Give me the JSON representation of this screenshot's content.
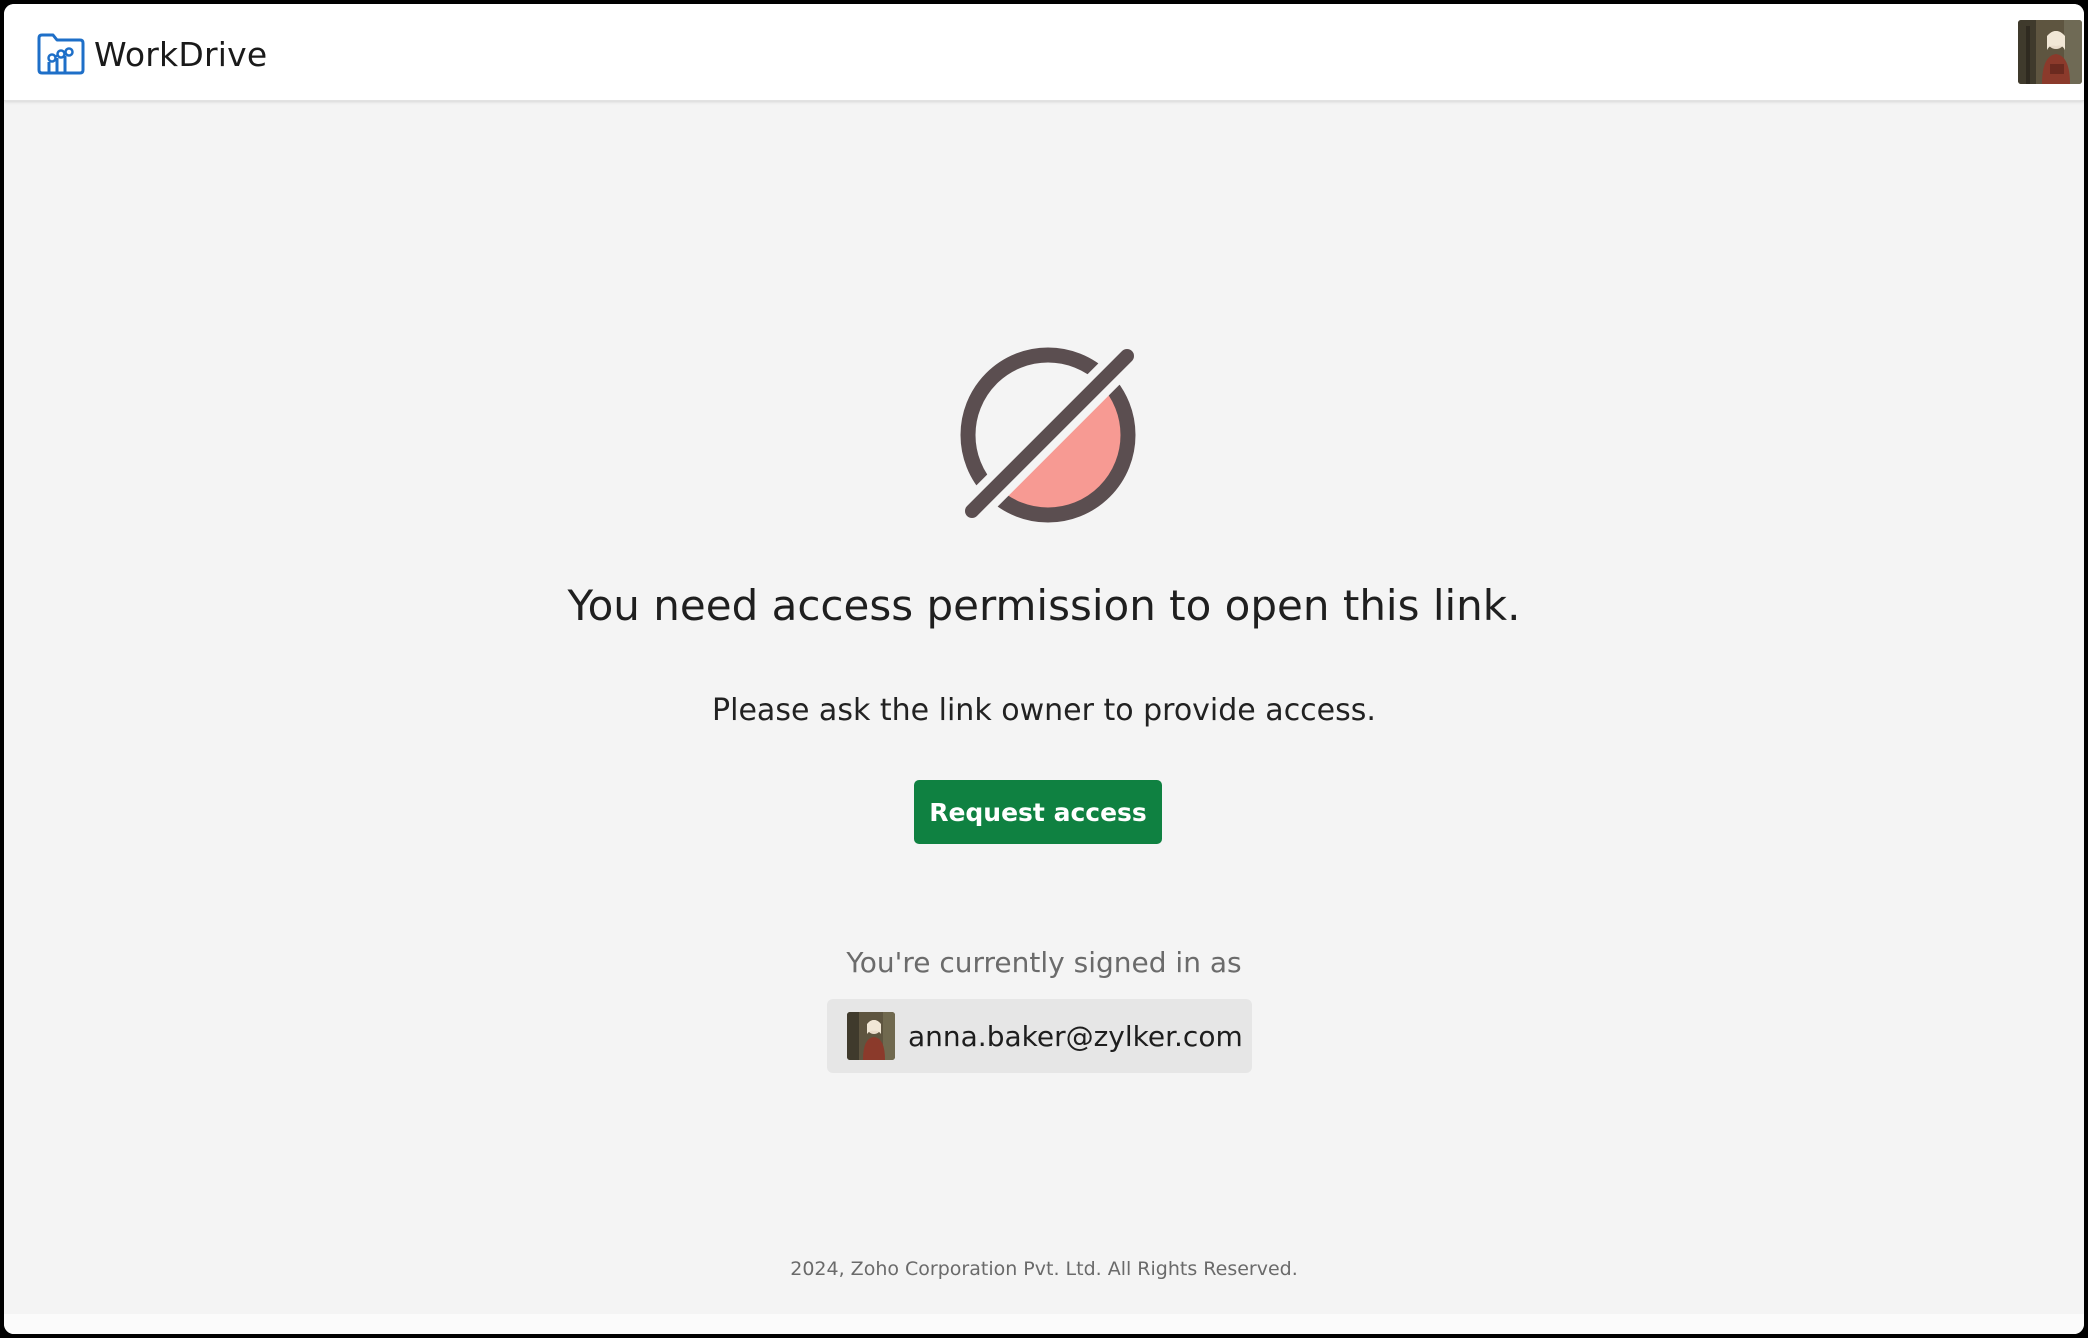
{
  "header": {
    "app_name": "WorkDrive",
    "logo_icon": "workdrive-folder-chart-icon",
    "avatar_icon": "user-avatar"
  },
  "main": {
    "status_icon": "access-denied-icon",
    "title": "You need access permission to open this link.",
    "subtitle": "Please ask the link owner to provide access.",
    "request_button_label": "Request access",
    "signed_in_label": "You're currently signed in as",
    "account_email": "anna.baker@zylker.com"
  },
  "footer": {
    "copyright": "2024, Zoho Corporation Pvt. Ltd. All Rights Reserved."
  },
  "colors": {
    "brand_blue": "#1e6fc8",
    "button_green": "#0f8141",
    "icon_dark": "#5b4e50",
    "icon_fill": "#f79a93",
    "background": "#f4f4f4"
  }
}
